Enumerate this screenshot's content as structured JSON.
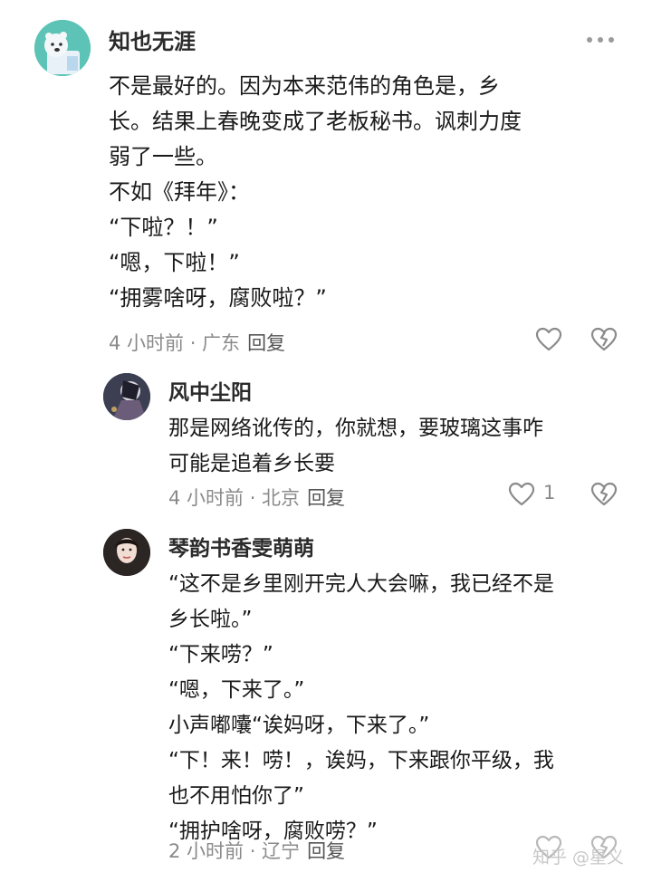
{
  "main_comment": {
    "username": "知也无涯",
    "text_lines": [
      "不是最好的。因为本来范伟的角色是，乡",
      "长。结果上春晚变成了老板秘书。讽刺力度",
      "弱了一些。",
      "不如《拜年》：",
      "“下啦？！”",
      "“嗯，下啦！”",
      "“拥雾啥呀，腐败啦？”"
    ],
    "meta": "4 小时前 · 广东",
    "reply_label": "回复"
  },
  "replies": [
    {
      "username": "风中尘阳",
      "text_lines": [
        "那是网络讹传的，你就想，要玻璃这事咋",
        "可能是追着乡长要"
      ],
      "meta": "4 小时前 · 北京",
      "reply_label": "回复",
      "like_count": "1"
    },
    {
      "username": "琴韵书香雯萌萌",
      "text_lines": [
        "“这不是乡里刚开完人大会嘛，我已经不是",
        "乡长啦。”",
        "“下来唠？”",
        "“嗯，下来了。”",
        "小声嘟囔“诶妈呀，下来了。”",
        "“下！来！唠！，诶妈，下来跟你平级，我",
        "也不用怕你了”",
        "“拥护啥呀，腐败唠？”"
      ],
      "meta": "2 小时前 · 辽宁",
      "reply_label": "回复"
    }
  ],
  "watermark": "知乎 @星义"
}
